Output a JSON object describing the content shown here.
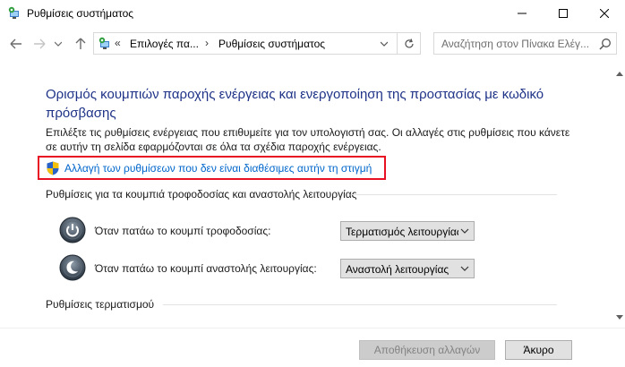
{
  "window": {
    "title": "Ρυθμίσεις συστήματος"
  },
  "address": {
    "chevron": "«",
    "crumb1": "Επιλογές πα...",
    "separator": "›",
    "crumb2": "Ρυθμίσεις συστήματος"
  },
  "search": {
    "placeholder": "Αναζήτηση στον Πίνακα Ελέγ..."
  },
  "main": {
    "title": "Ορισμός κουμπιών παροχής ενέργειας και ενεργοποίηση της προστασίας με κωδικό πρόσβασης",
    "description": "Επιλέξτε τις ρυθμίσεις ενέργειας που επιθυμείτε για τον υπολογιστή σας. Οι αλλαγές στις ρυθμίσεις που κάνετε σε αυτήν τη σελίδα εφαρμόζονται σε όλα τα σχέδια παροχής ενέργειας.",
    "change_link": "Αλλαγή των ρυθμίσεων που δεν είναι διαθέσιμες αυτήν τη στιγμή"
  },
  "power_section": {
    "heading": "Ρυθμίσεις για τα κουμπιά τροφοδοσίας και αναστολής λειτουργίας",
    "rows": [
      {
        "label": "Όταν πατάω το κουμπί τροφοδοσίας:",
        "value": "Τερματισμός λειτουργίας",
        "icon": "power-button-icon"
      },
      {
        "label": "Όταν πατάω το κουμπί αναστολής λειτουργίας:",
        "value": "Αναστολή λειτουργίας",
        "icon": "sleep-button-icon"
      }
    ]
  },
  "shutdown_section": {
    "heading": "Ρυθμίσεις τερματισμού"
  },
  "footer": {
    "save_label": "Αποθήκευση αλλαγών",
    "cancel_label": "Άκυρο"
  },
  "colors": {
    "title_blue": "#1e3287",
    "link_blue": "#0066cc",
    "highlight_red": "#e81123"
  }
}
